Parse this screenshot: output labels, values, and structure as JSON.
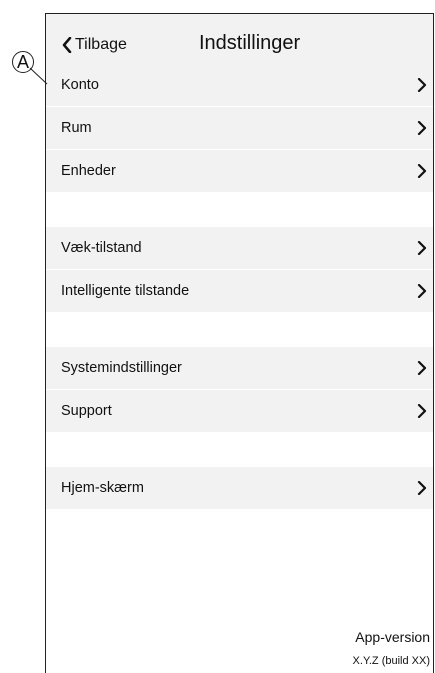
{
  "header": {
    "back_label": "Tilbage",
    "title": "Indstillinger"
  },
  "groups": [
    {
      "items": [
        {
          "label": "Konto"
        },
        {
          "label": "Rum"
        },
        {
          "label": "Enheder"
        }
      ]
    },
    {
      "items": [
        {
          "label": "Væk-tilstand"
        },
        {
          "label": "Intelligente tilstande"
        }
      ]
    },
    {
      "items": [
        {
          "label": "Systemindstillinger"
        },
        {
          "label": "Support"
        }
      ]
    },
    {
      "items": [
        {
          "label": "Hjem-skærm"
        }
      ]
    }
  ],
  "footer": {
    "version_label": "App-version",
    "version_number": "X.Y.Z (build XX)"
  },
  "callout": {
    "label": "A"
  },
  "icons": {
    "back": "chevron-left-icon",
    "row": "chevron-right-icon"
  },
  "colors": {
    "row_background": "#f2f2f2",
    "spacer_background": "#ffffff",
    "text": "#111111"
  }
}
